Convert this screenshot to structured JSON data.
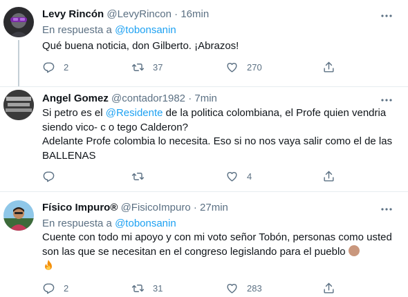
{
  "tweets": [
    {
      "name": "Levy Rincón",
      "handle": "@LevyRincon",
      "dot": "·",
      "time": "16min",
      "reply_prefix": "En respuesta a",
      "reply_to": "@tobonsanin",
      "text": "Qué buena noticia, don Gilberto. ¡Abrazos!",
      "replies": "2",
      "retweets": "37",
      "likes": "270"
    },
    {
      "name": "Angel Gomez",
      "handle": "@contador1982",
      "dot": "·",
      "time": "7min",
      "text_before_mention": "Si petro es el ",
      "mention": "@Residente",
      "text_after_mention": " de la politica colombiana, el Profe quien vendria siendo vico- c o tego Calderon?",
      "text_line2": "Adelante Profe colombia lo necesita. Eso si no nos vaya salir como el de las BALLENAS",
      "replies": "",
      "retweets": "",
      "likes": "4"
    },
    {
      "name": "Físico Impuro®",
      "handle": "@FisicoImpuro",
      "dot": "·",
      "time": "27min",
      "reply_prefix": "En respuesta a",
      "reply_to": "@tobonsanin",
      "text": "Cuente con todo mi apoyo y con mi voto señor Tobón, personas como usted son las  que se necesitan en el congreso legislando para el pueblo",
      "replies": "2",
      "retweets": "31",
      "likes": "283"
    }
  ],
  "icons": {
    "reply": "reply-icon",
    "retweet": "retweet-icon",
    "like": "heart-icon",
    "share": "share-icon",
    "more": "more-icon",
    "fist": "raised-fist-emoji",
    "fire": "fire-emoji"
  },
  "colors": {
    "link": "#1da1f2",
    "secondary_text": "#5b7083",
    "primary_text": "#0f1419",
    "divider": "#e6ecf0",
    "thread_line": "#c4cfd6"
  }
}
